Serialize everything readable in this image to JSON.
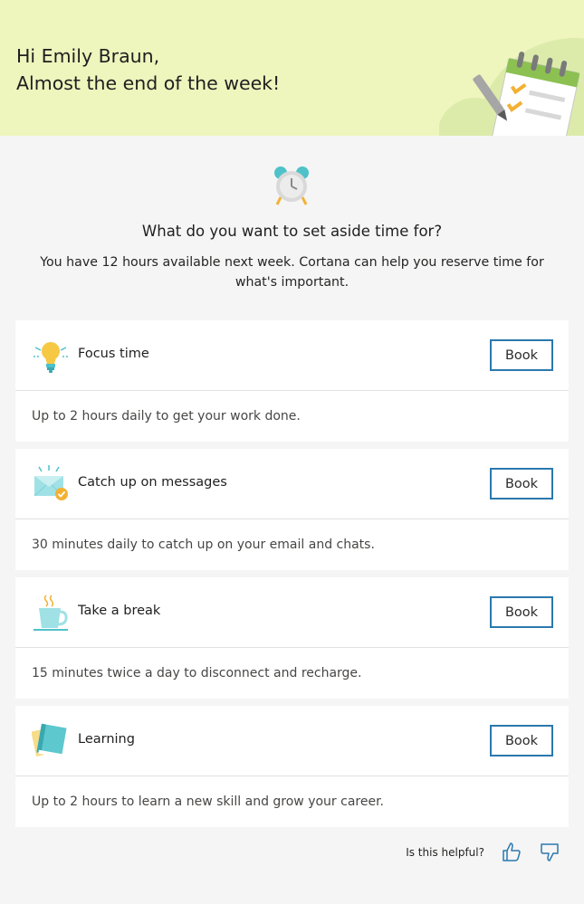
{
  "header": {
    "greeting_line1": "Hi Emily Braun,",
    "greeting_line2": "Almost the end of the week!",
    "background_color": "#eef5bd",
    "illustration_icon": "planner-notepad-icon"
  },
  "intro": {
    "icon": "alarm-clock-icon",
    "question": "What do you want to set aside time for?",
    "subtext": "You have 12 hours available next week. Cortana can help you reserve time for what's important."
  },
  "cards": [
    {
      "icon": "lightbulb-icon",
      "title": "Focus time",
      "button": "Book",
      "description": "Up to 2 hours daily to get your work done."
    },
    {
      "icon": "envelope-icon",
      "title": "Catch up on messages",
      "button": "Book",
      "description": "30 minutes daily to catch up on your email and chats."
    },
    {
      "icon": "coffee-cup-icon",
      "title": "Take a break",
      "button": "Book",
      "description": "15 minutes twice a day to disconnect and recharge."
    },
    {
      "icon": "book-icon",
      "title": "Learning",
      "button": "Book",
      "description": "Up to 2 hours to learn a new skill and grow your career."
    }
  ],
  "feedback": {
    "prompt": "Is this helpful?",
    "thumbs_up_icon": "thumbs-up-icon",
    "thumbs_down_icon": "thumbs-down-icon"
  },
  "colors": {
    "accent": "#2b78ad",
    "page_background": "#f5f5f5"
  }
}
